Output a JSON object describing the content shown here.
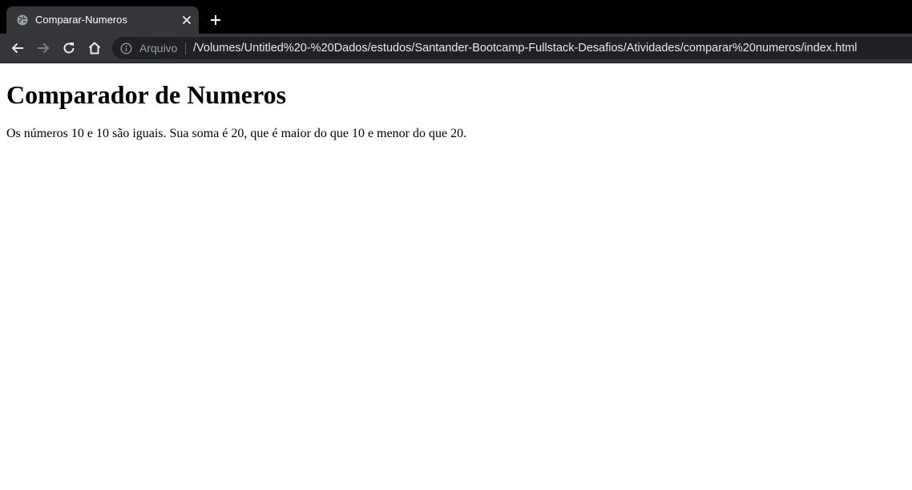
{
  "browser": {
    "tab": {
      "title": "Comparar-Numeros",
      "favicon": "globe-icon"
    },
    "toolbar": {
      "back_icon": "back-arrow-icon",
      "forward_icon": "forward-arrow-icon",
      "reload_icon": "reload-icon",
      "home_icon": "home-icon"
    },
    "omnibox": {
      "scheme_label": "Arquivo",
      "url": "/Volumes/Untitled%20-%20Dados/estudos/Santander-Bootcamp-Fullstack-Desafios/Atividades/comparar%20numeros/index.html"
    }
  },
  "page": {
    "heading": "Comparador de Numeros",
    "result": "Os números 10 e 10 são iguais. Sua soma é 20, que é maior do que 10 e menor do que 20."
  },
  "colors": {
    "tabstrip": "#000000",
    "toolbar": "#35363a",
    "omnibox": "#202124",
    "url_text": "#e8eaed",
    "scheme_text": "#9aa0a6"
  }
}
